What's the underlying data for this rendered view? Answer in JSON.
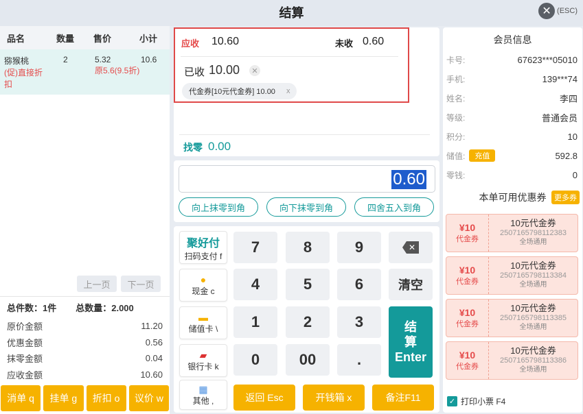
{
  "title": "结算",
  "close": {
    "label": "(ESC)"
  },
  "order": {
    "headers": [
      "品名",
      "数量",
      "售价",
      "小计"
    ],
    "items": [
      {
        "name": "猕猴桃",
        "promo_line1": "(促)直接折",
        "promo_line2": "扣",
        "qty": "2",
        "price": "5.32",
        "orig_price": "原5.6(9.5折)",
        "subtotal": "10.6"
      }
    ],
    "pager": {
      "prev": "上一页",
      "next": "下一页"
    },
    "summary": {
      "total_kinds": "总件数：1件",
      "total_qty": "总数量：2.000",
      "rows": [
        {
          "label": "原价金额",
          "value": "11.20"
        },
        {
          "label": "优惠金额",
          "value": "0.56"
        },
        {
          "label": "抹零金额",
          "value": "0.04"
        },
        {
          "label": "应收金额",
          "value": "10.60"
        }
      ]
    },
    "buttons": [
      "消单 q",
      "挂单 g",
      "折扣 o",
      "议价 w"
    ]
  },
  "payment": {
    "due_label": "应收",
    "due_value": "10.60",
    "unpaid_label": "未收",
    "unpaid_value": "0.60",
    "paid_label": "已收",
    "paid_value": "10.00",
    "coupon_chip": "代金券[10元代金券] 10.00",
    "change_label": "找零",
    "change_value": "0.00",
    "input_value": "0.60",
    "round_buttons": [
      "向上抹零到角",
      "向下抹零到角",
      "四舍五入到角"
    ]
  },
  "pay_methods": [
    {
      "brand": "聚好付",
      "label": "扫码支付 f"
    },
    {
      "label": "现金 c"
    },
    {
      "label": "储值卡 \\"
    },
    {
      "label": "银行卡 k"
    },
    {
      "label": "其他 ,"
    }
  ],
  "keypad": {
    "keys": [
      "7",
      "8",
      "9",
      "4",
      "5",
      "6",
      "1",
      "2",
      "3",
      "0",
      "00",
      "."
    ],
    "clear": "清空",
    "enter_line1": "结",
    "enter_line2": "算",
    "enter_line3": "Enter",
    "bottom_buttons": [
      "返回 Esc",
      "开钱箱 x",
      "备注F11"
    ]
  },
  "member": {
    "title": "会员信息",
    "rows": [
      {
        "label": "卡号:",
        "value": "67623***05010"
      },
      {
        "label": "手机:",
        "value": "139***74"
      },
      {
        "label": "姓名:",
        "value": "李四"
      },
      {
        "label": "等级:",
        "value": "普通会员"
      },
      {
        "label": "积分:",
        "value": "10"
      },
      {
        "label": "储值:",
        "value": "592.8",
        "action": "充值"
      },
      {
        "label": "零钱:",
        "value": "0"
      }
    ],
    "coupons_title": "本单可用优惠券",
    "more": "更多券",
    "coupons": [
      {
        "amount": "¥10",
        "type": "代金券",
        "name": "10元代金券",
        "code": "2507165798112383",
        "scope": "全场通用"
      },
      {
        "amount": "¥10",
        "type": "代金券",
        "name": "10元代金券",
        "code": "2507165798113384",
        "scope": "全场通用"
      },
      {
        "amount": "¥10",
        "type": "代金券",
        "name": "10元代金券",
        "code": "2507165798113385",
        "scope": "全场通用"
      },
      {
        "amount": "¥10",
        "type": "代金券",
        "name": "10元代金券",
        "code": "2507165798113386",
        "scope": "全场通用"
      }
    ],
    "print_label": "打印小票 F4"
  },
  "colors": {
    "teal": "#149a9a",
    "orange": "#f6b200",
    "red": "#e54b4b",
    "select": "#1e5ccc"
  }
}
